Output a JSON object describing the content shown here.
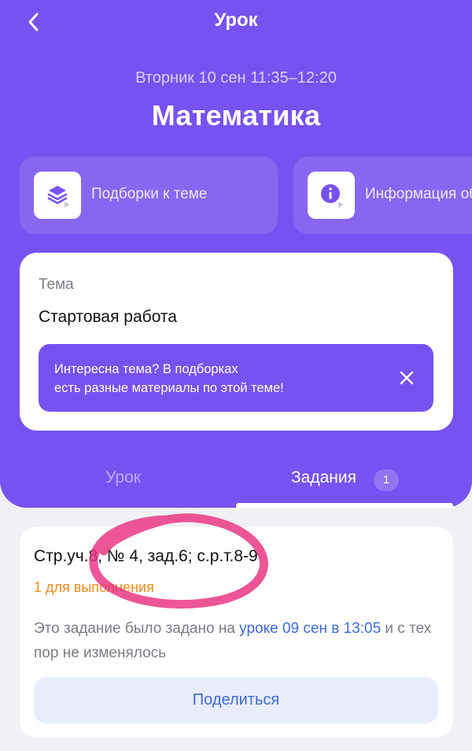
{
  "nav": {
    "title": "Урок"
  },
  "lesson": {
    "datetime": "Вторник 10 сен  11:35–12:20",
    "subject": "Математика"
  },
  "quick_actions": [
    {
      "label": "Подборки к теме",
      "icon": "layers-stack-icon"
    },
    {
      "label": "Информация об",
      "icon": "info-icon"
    }
  ],
  "topic": {
    "label": "Тема",
    "value": "Стартовая работа",
    "banner_line1": "Интересна тема? В подборках",
    "banner_line2": "есть разные материалы по этой теме!"
  },
  "tabs": [
    {
      "label": "Урок",
      "active": false
    },
    {
      "label": "Задания",
      "active": true,
      "badge": "1"
    }
  ],
  "task": {
    "title": "Стр.уч.8, № 4, зад.6; с.р.т.8-9",
    "status": "1 для выполнения",
    "info_prefix": "Это задание было задано на ",
    "info_link": "уроке 09 сен в 13:05",
    "info_suffix": " и с тех пор не изменялось",
    "share_label": "Поделиться"
  },
  "colors": {
    "brand_purple": "#7752f0",
    "status_orange": "#f08a1c",
    "link_blue": "#3d6ad8",
    "annotation_pink": "#e8317f"
  }
}
